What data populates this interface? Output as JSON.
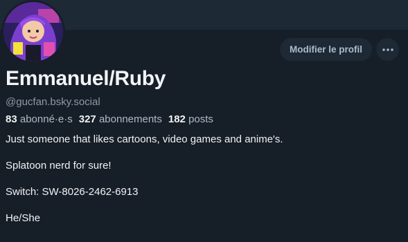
{
  "profile": {
    "display_name": "Emmanuel/Ruby",
    "handle": "@gucfan.bsky.social",
    "edit_button_label": "Modifier le profil",
    "avatar_icon": "avatar-image",
    "more_icon": "more-dots-icon"
  },
  "stats": {
    "followers_count": "83",
    "followers_label": "abonné·e·s",
    "following_count": "327",
    "following_label": "abonnements",
    "posts_count": "182",
    "posts_label": "posts"
  },
  "bio": {
    "lines": [
      "Just someone that likes cartoons, video games and anime's.",
      "Splatoon nerd for sure!",
      "Switch: SW-8026-2462-6913",
      "He/She"
    ]
  },
  "colors": {
    "background": "#161e27",
    "banner": "#1e2936",
    "muted_text": "#8d9aab",
    "button_bg": "#1e2936"
  }
}
